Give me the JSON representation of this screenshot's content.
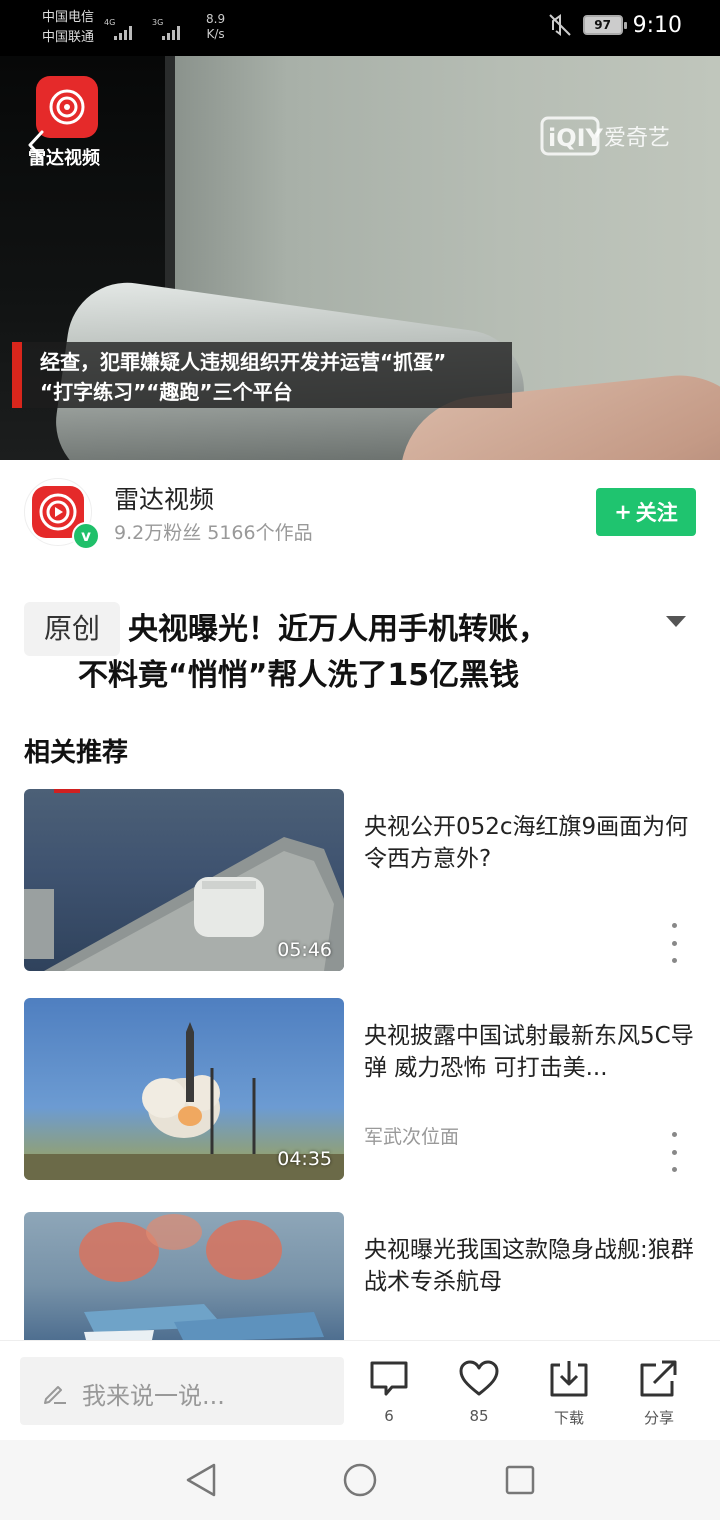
{
  "status_bar": {
    "carrier_1": "中国电信",
    "carrier_2": "中国联通",
    "sim1_network": "4G",
    "sim2_network": "3G",
    "speed_value": "8.9",
    "speed_unit": "K/s",
    "battery": "97",
    "time": "9:10"
  },
  "video": {
    "channel_logo_text": "雷达视频",
    "watermark": "爱奇艺",
    "caption_line_1": "经查，犯罪嫌疑人违规组织开发并运营“抓蛋”",
    "caption_line_2": "“打字练习”“趣跑”三个平台"
  },
  "author": {
    "name": "雷达视频",
    "stats": "9.2万粉丝 5166个作品",
    "verified_badge": "v",
    "follow_label": "关注",
    "follow_plus": "+"
  },
  "article": {
    "tag": "原创",
    "title_line_1": "央视曝光！近万人用手机转账，",
    "title_line_2": "不料竟“悄悄”帮人洗了15亿黑钱"
  },
  "recommendations": {
    "heading": "相关推荐",
    "items": [
      {
        "title": "央视公开052c海红旗9画面为何令西方意外?",
        "duration": "05:46",
        "source": ""
      },
      {
        "title": "央视披露中国试射最新东风5C导弹 威力恐怖 可打击美...",
        "duration": "04:35",
        "source": "军武次位面"
      },
      {
        "title": "央视曝光我国这款隐身战舰:狼群战术专杀航母",
        "duration": "",
        "source": ""
      }
    ]
  },
  "comment_bar": {
    "placeholder": "我来说一说...",
    "comments_count": "6",
    "likes_count": "85",
    "download_label": "下载",
    "share_label": "分享"
  },
  "colors": {
    "accent_green": "#1fc46f",
    "brand_red": "#e52a2a",
    "caption_red": "#d9261c"
  },
  "icons": [
    "mute-icon",
    "battery-icon",
    "back-arrow-icon",
    "radar-logo-icon",
    "iqiyi-logo-icon",
    "chevron-down-icon",
    "more-icon",
    "pencil-icon",
    "comment-icon",
    "heart-icon",
    "download-icon",
    "share-icon",
    "nav-back-icon",
    "nav-home-icon",
    "nav-recents-icon"
  ]
}
